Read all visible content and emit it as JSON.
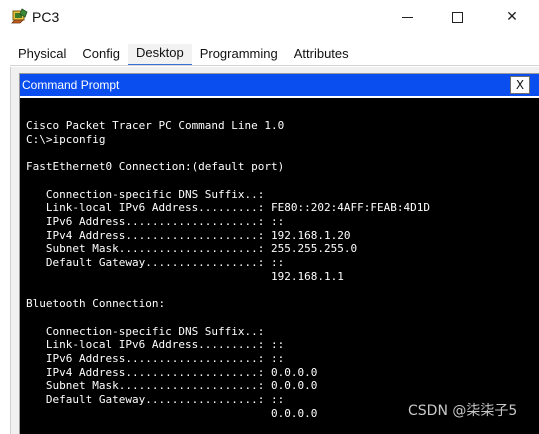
{
  "window": {
    "title": "PC3",
    "minimize_symbol": "",
    "close_symbol": "✕"
  },
  "tabs": [
    {
      "label": "Physical"
    },
    {
      "label": "Config"
    },
    {
      "label": "Desktop",
      "active": true
    },
    {
      "label": "Programming"
    },
    {
      "label": "Attributes"
    }
  ],
  "command_prompt": {
    "title": "Command Prompt",
    "close_label": "X",
    "header_color": "#0a4ef0",
    "console_bg": "#000000",
    "console_fg": "#ffffff",
    "lines": [
      "Cisco Packet Tracer PC Command Line 1.0",
      "C:\\>ipconfig",
      "",
      "FastEthernet0 Connection:(default port)",
      "",
      "   Connection-specific DNS Suffix..: ",
      "   Link-local IPv6 Address.........: FE80::202:4AFF:FEAB:4D1D",
      "   IPv6 Address....................: ::",
      "   IPv4 Address....................: 192.168.1.20",
      "   Subnet Mask.....................: 255.255.255.0",
      "   Default Gateway.................: ::",
      "                                     192.168.1.1",
      "",
      "Bluetooth Connection:",
      "",
      "   Connection-specific DNS Suffix..: ",
      "   Link-local IPv6 Address.........: ::",
      "   IPv6 Address....................: ::",
      "   IPv4 Address....................: 0.0.0.0",
      "   Subnet Mask.....................: 0.0.0.0",
      "   Default Gateway.................: ::",
      "                                     0.0.0.0"
    ]
  },
  "watermark": "CSDN @柒柒子5"
}
